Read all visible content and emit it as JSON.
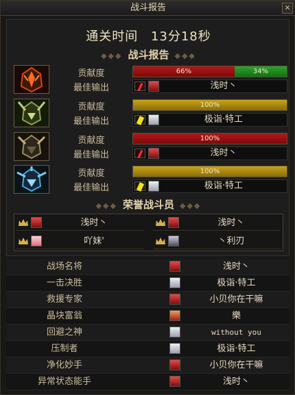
{
  "window": {
    "title": "战斗报告",
    "close_glyph": "✕"
  },
  "clear_time": {
    "label": "通关时间",
    "value": "13分18秒"
  },
  "report": {
    "title": "战斗报告",
    "contribution_label": "贡献度",
    "best_output_label": "最佳输出",
    "players": [
      {
        "portrait": "red-flame-helmet-icon",
        "bar_type": "split",
        "red_pct": 66,
        "red_text": "66%",
        "green_pct": 34,
        "green_text": "34%",
        "weapon": "red",
        "avatar": "red",
        "best_output": "浅时丶"
      },
      {
        "portrait": "green-horned-helmet-icon",
        "bar_type": "gold",
        "gold_pct": 100,
        "gold_text": "100%",
        "weapon": "yellow",
        "avatar": "white",
        "best_output": "极诣·特工"
      },
      {
        "portrait": "dark-horned-helmet-icon",
        "bar_type": "red",
        "red_pct": 100,
        "red_text": "100%",
        "weapon": "red",
        "avatar": "red",
        "best_output": "浅时丶"
      },
      {
        "portrait": "blue-spiked-helmet-icon",
        "bar_type": "gold",
        "gold_pct": 100,
        "gold_text": "100%",
        "weapon": "yellow",
        "avatar": "white",
        "best_output": "极诣·特工"
      }
    ]
  },
  "honor": {
    "title": "荣誉战斗员",
    "members": [
      {
        "name": "浅时丶",
        "avatar": "red"
      },
      {
        "name": "浅时丶",
        "avatar": "red"
      },
      {
        "name": "吖妹'",
        "avatar": "pink"
      },
      {
        "name": "丶利刃",
        "avatar": "dark"
      }
    ]
  },
  "awards": [
    {
      "title": "战场名将",
      "name": "浅时丶",
      "avatar": "red"
    },
    {
      "title": "一击决胜",
      "name": "极诣·特工",
      "avatar": "white"
    },
    {
      "title": "救援专家",
      "name": "小贝你在干嘛",
      "avatar": "red"
    },
    {
      "title": "晶块富翁",
      "name": "樂",
      "avatar": "orange"
    },
    {
      "title": "回避之神",
      "name": "without you",
      "avatar": "white"
    },
    {
      "title": "压制者",
      "name": "极诣·特工",
      "avatar": "white"
    },
    {
      "title": "净化妙手",
      "name": "小贝你在干嘛",
      "avatar": "red"
    },
    {
      "title": "异常状态能手",
      "name": "浅时丶",
      "avatar": "red"
    }
  ],
  "colors": {
    "red_bar": "#b01818",
    "green_bar": "#2aa52a",
    "gold_bar": "#c9a318",
    "portrait_red": "#e04010",
    "portrait_green": "#8aa84a",
    "portrait_dark": "#a08a60",
    "portrait_blue": "#4aa8d8"
  }
}
